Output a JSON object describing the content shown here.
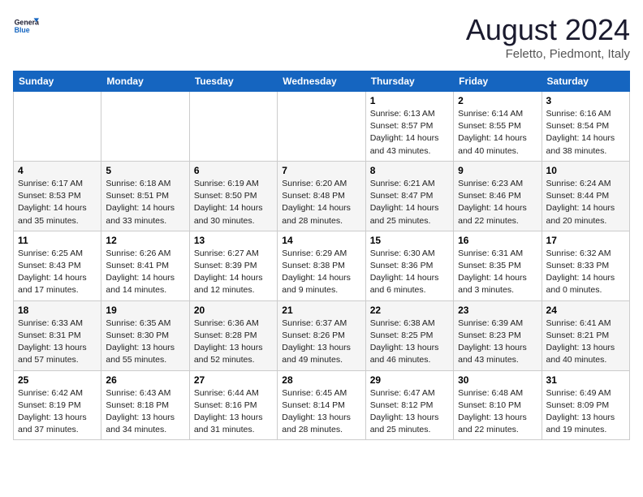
{
  "header": {
    "logo_general": "General",
    "logo_blue": "Blue",
    "month": "August 2024",
    "location": "Feletto, Piedmont, Italy"
  },
  "weekdays": [
    "Sunday",
    "Monday",
    "Tuesday",
    "Wednesday",
    "Thursday",
    "Friday",
    "Saturday"
  ],
  "weeks": [
    [
      {
        "day": "",
        "info": ""
      },
      {
        "day": "",
        "info": ""
      },
      {
        "day": "",
        "info": ""
      },
      {
        "day": "",
        "info": ""
      },
      {
        "day": "1",
        "info": "Sunrise: 6:13 AM\nSunset: 8:57 PM\nDaylight: 14 hours\nand 43 minutes."
      },
      {
        "day": "2",
        "info": "Sunrise: 6:14 AM\nSunset: 8:55 PM\nDaylight: 14 hours\nand 40 minutes."
      },
      {
        "day": "3",
        "info": "Sunrise: 6:16 AM\nSunset: 8:54 PM\nDaylight: 14 hours\nand 38 minutes."
      }
    ],
    [
      {
        "day": "4",
        "info": "Sunrise: 6:17 AM\nSunset: 8:53 PM\nDaylight: 14 hours\nand 35 minutes."
      },
      {
        "day": "5",
        "info": "Sunrise: 6:18 AM\nSunset: 8:51 PM\nDaylight: 14 hours\nand 33 minutes."
      },
      {
        "day": "6",
        "info": "Sunrise: 6:19 AM\nSunset: 8:50 PM\nDaylight: 14 hours\nand 30 minutes."
      },
      {
        "day": "7",
        "info": "Sunrise: 6:20 AM\nSunset: 8:48 PM\nDaylight: 14 hours\nand 28 minutes."
      },
      {
        "day": "8",
        "info": "Sunrise: 6:21 AM\nSunset: 8:47 PM\nDaylight: 14 hours\nand 25 minutes."
      },
      {
        "day": "9",
        "info": "Sunrise: 6:23 AM\nSunset: 8:46 PM\nDaylight: 14 hours\nand 22 minutes."
      },
      {
        "day": "10",
        "info": "Sunrise: 6:24 AM\nSunset: 8:44 PM\nDaylight: 14 hours\nand 20 minutes."
      }
    ],
    [
      {
        "day": "11",
        "info": "Sunrise: 6:25 AM\nSunset: 8:43 PM\nDaylight: 14 hours\nand 17 minutes."
      },
      {
        "day": "12",
        "info": "Sunrise: 6:26 AM\nSunset: 8:41 PM\nDaylight: 14 hours\nand 14 minutes."
      },
      {
        "day": "13",
        "info": "Sunrise: 6:27 AM\nSunset: 8:39 PM\nDaylight: 14 hours\nand 12 minutes."
      },
      {
        "day": "14",
        "info": "Sunrise: 6:29 AM\nSunset: 8:38 PM\nDaylight: 14 hours\nand 9 minutes."
      },
      {
        "day": "15",
        "info": "Sunrise: 6:30 AM\nSunset: 8:36 PM\nDaylight: 14 hours\nand 6 minutes."
      },
      {
        "day": "16",
        "info": "Sunrise: 6:31 AM\nSunset: 8:35 PM\nDaylight: 14 hours\nand 3 minutes."
      },
      {
        "day": "17",
        "info": "Sunrise: 6:32 AM\nSunset: 8:33 PM\nDaylight: 14 hours\nand 0 minutes."
      }
    ],
    [
      {
        "day": "18",
        "info": "Sunrise: 6:33 AM\nSunset: 8:31 PM\nDaylight: 13 hours\nand 57 minutes."
      },
      {
        "day": "19",
        "info": "Sunrise: 6:35 AM\nSunset: 8:30 PM\nDaylight: 13 hours\nand 55 minutes."
      },
      {
        "day": "20",
        "info": "Sunrise: 6:36 AM\nSunset: 8:28 PM\nDaylight: 13 hours\nand 52 minutes."
      },
      {
        "day": "21",
        "info": "Sunrise: 6:37 AM\nSunset: 8:26 PM\nDaylight: 13 hours\nand 49 minutes."
      },
      {
        "day": "22",
        "info": "Sunrise: 6:38 AM\nSunset: 8:25 PM\nDaylight: 13 hours\nand 46 minutes."
      },
      {
        "day": "23",
        "info": "Sunrise: 6:39 AM\nSunset: 8:23 PM\nDaylight: 13 hours\nand 43 minutes."
      },
      {
        "day": "24",
        "info": "Sunrise: 6:41 AM\nSunset: 8:21 PM\nDaylight: 13 hours\nand 40 minutes."
      }
    ],
    [
      {
        "day": "25",
        "info": "Sunrise: 6:42 AM\nSunset: 8:19 PM\nDaylight: 13 hours\nand 37 minutes."
      },
      {
        "day": "26",
        "info": "Sunrise: 6:43 AM\nSunset: 8:18 PM\nDaylight: 13 hours\nand 34 minutes."
      },
      {
        "day": "27",
        "info": "Sunrise: 6:44 AM\nSunset: 8:16 PM\nDaylight: 13 hours\nand 31 minutes."
      },
      {
        "day": "28",
        "info": "Sunrise: 6:45 AM\nSunset: 8:14 PM\nDaylight: 13 hours\nand 28 minutes."
      },
      {
        "day": "29",
        "info": "Sunrise: 6:47 AM\nSunset: 8:12 PM\nDaylight: 13 hours\nand 25 minutes."
      },
      {
        "day": "30",
        "info": "Sunrise: 6:48 AM\nSunset: 8:10 PM\nDaylight: 13 hours\nand 22 minutes."
      },
      {
        "day": "31",
        "info": "Sunrise: 6:49 AM\nSunset: 8:09 PM\nDaylight: 13 hours\nand 19 minutes."
      }
    ]
  ]
}
